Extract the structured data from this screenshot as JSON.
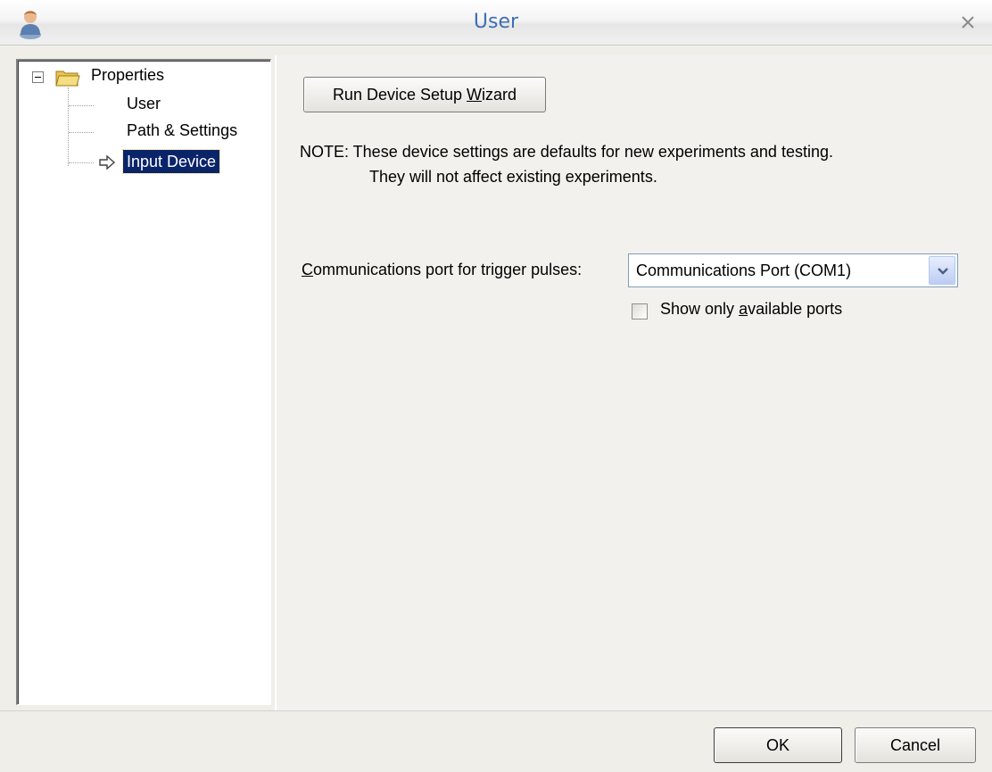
{
  "window": {
    "title": "User",
    "icon": "user-icon",
    "close_icon": "close-icon"
  },
  "tree": {
    "root_label": "Properties",
    "root_icon": "folder-open-icon",
    "expander_icon": "minus-expander-icon",
    "items": [
      {
        "label": "User",
        "selected": false
      },
      {
        "label": "Path & Settings",
        "selected": false
      },
      {
        "label": "Input Device",
        "selected": true,
        "icon": "arrow-right-icon"
      }
    ]
  },
  "main": {
    "wizard_button": {
      "pre": "Run Device Setup ",
      "mnemonic": "W",
      "post": "izard"
    },
    "note_line1": "NOTE: These device settings are defaults for new experiments and testing.",
    "note_line2": "They will not affect existing experiments.",
    "port_label": {
      "mnemonic": "C",
      "post": "ommunications port for trigger pulses:"
    },
    "port_value": "Communications Port (COM1)",
    "checkbox": {
      "pre": "Show only ",
      "mnemonic": "a",
      "post": "vailable ports",
      "checked": false
    }
  },
  "footer": {
    "ok_label": "OK",
    "cancel_label": "Cancel"
  },
  "colors": {
    "title_text": "#3f6fb4",
    "selection_bg": "#0a246a",
    "selection_text": "#ffffff"
  }
}
